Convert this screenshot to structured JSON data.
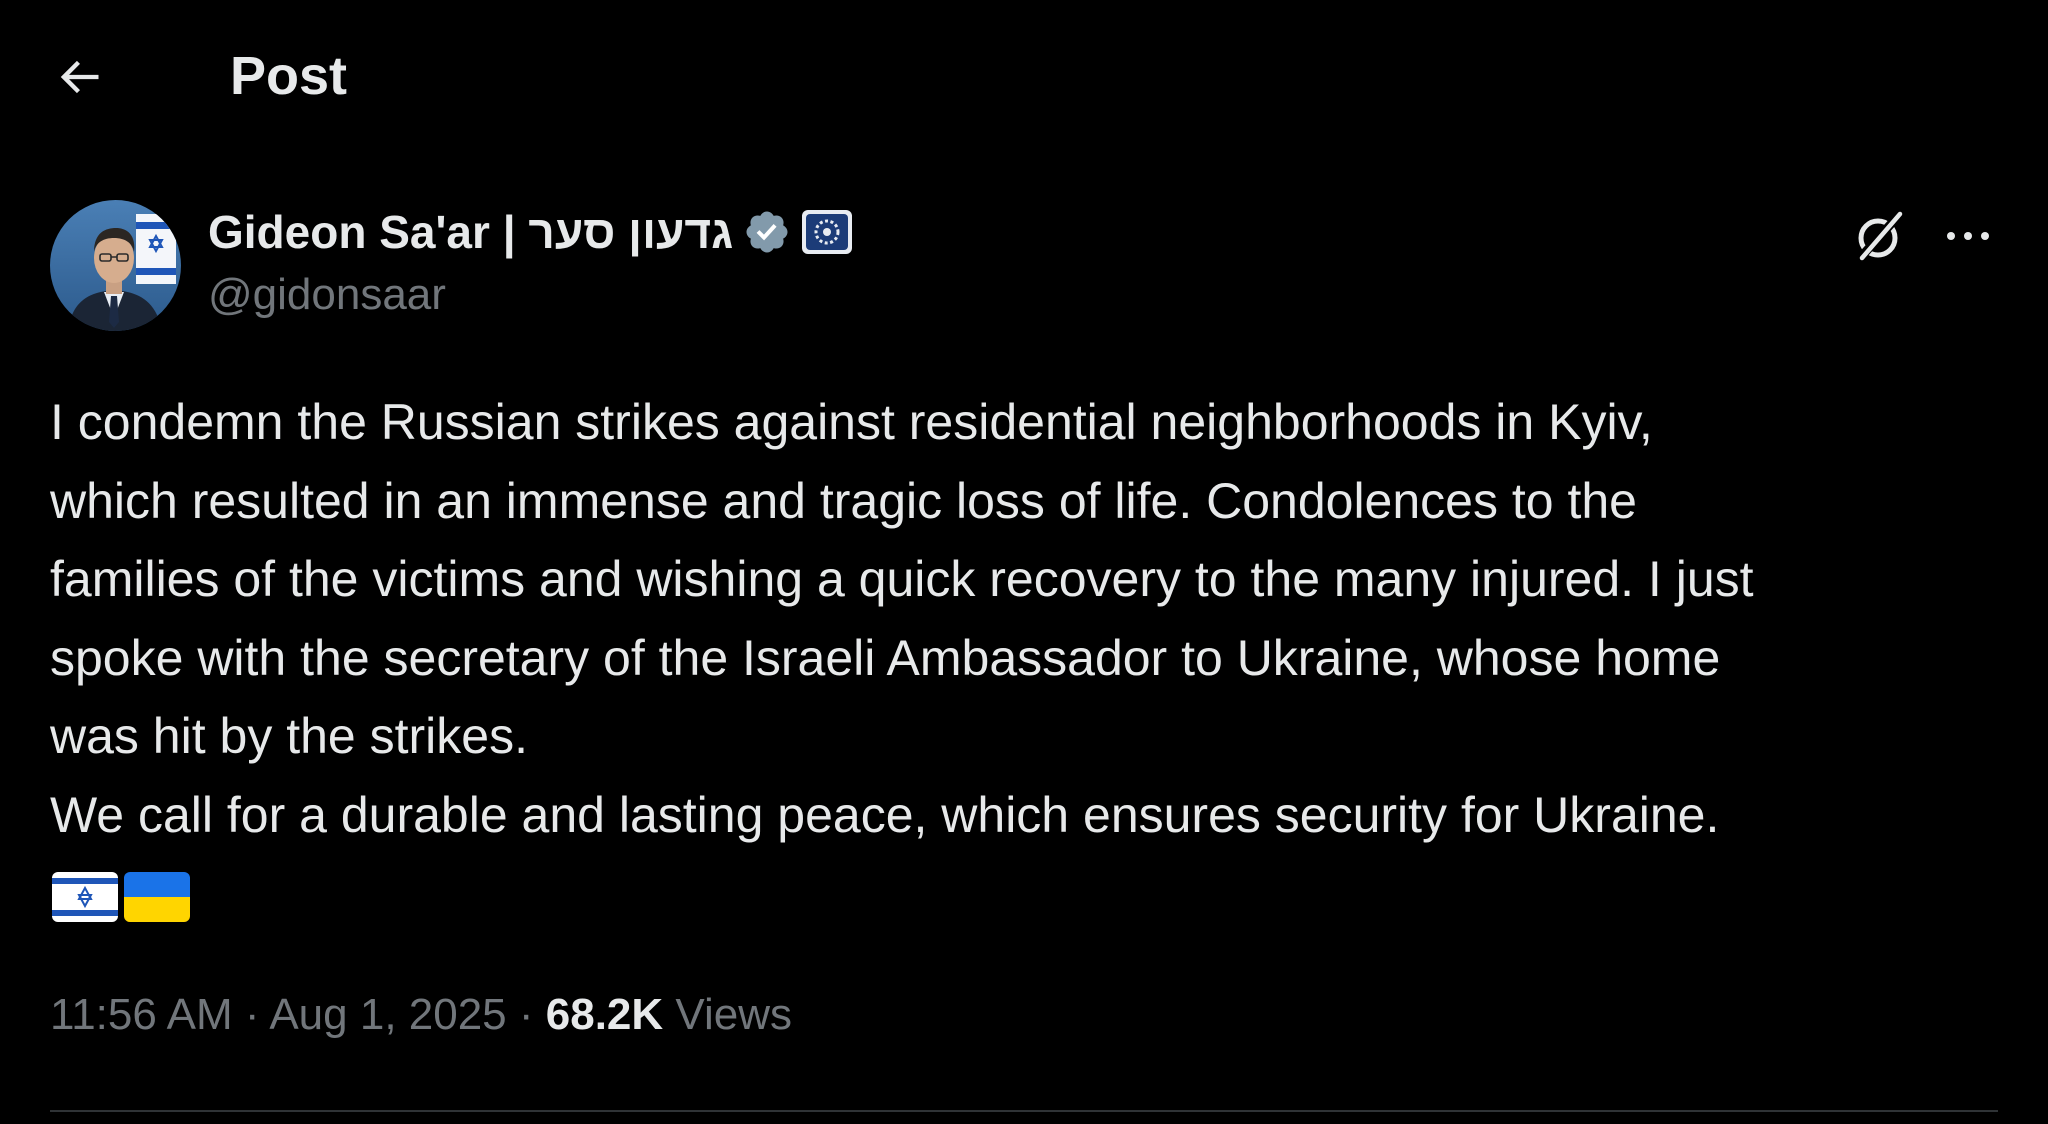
{
  "header": {
    "title": "Post",
    "back_icon": "arrow-left-icon"
  },
  "author": {
    "display_name": "Gideon Sa'ar | גדעון סער",
    "handle": "@gidonsaar",
    "verified_icon": "verified-badge-icon",
    "affiliate_icon": "affiliation-badge-icon",
    "avatar": "profile-photo"
  },
  "actions": {
    "grok_icon": "grok-icon",
    "more_icon": "more-options-icon"
  },
  "post": {
    "text": "I condemn the Russian strikes against residential neighborhoods in Kyiv,\nwhich resulted in an immense and tragic loss of life. Condolences to the\nfamilies of the victims and wishing a quick recovery to the many injured. I just\nspoke with the secretary of the Israeli Ambassador to Ukraine, whose home\nwas hit by the strikes.\nWe call for a durable and lasting peace, which ensures security for Ukraine.",
    "flags": [
      "israel-flag",
      "ukraine-flag"
    ]
  },
  "meta": {
    "time": "11:56 AM",
    "separator": " · ",
    "date": "Aug 1, 2025",
    "views_count": "68.2K",
    "views_label": "Views"
  },
  "colors": {
    "background": "#000000",
    "text_primary": "#e7e9ea",
    "text_secondary": "#71767b",
    "verified_badge": "#829aab",
    "divider": "#2f3336"
  }
}
